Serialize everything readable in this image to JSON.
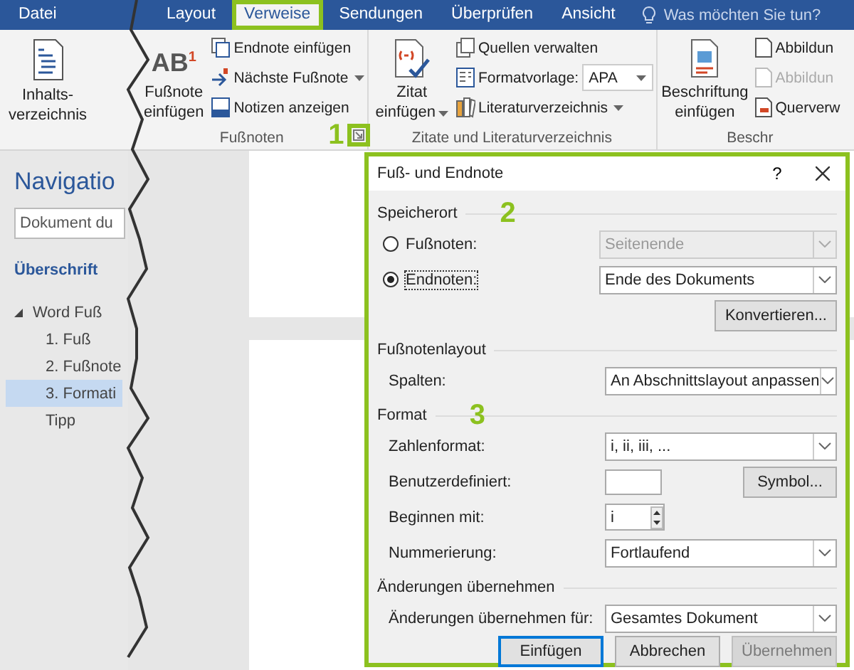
{
  "tabs": [
    {
      "label": "Datei",
      "selected": false
    },
    {
      "label": "Layout",
      "selected": false
    },
    {
      "label": "Verweise",
      "selected": true
    },
    {
      "label": "Sendungen",
      "selected": false
    },
    {
      "label": "Überprüfen",
      "selected": false
    },
    {
      "label": "Ansicht",
      "selected": false
    }
  ],
  "tell_me": "Was möchten Sie tun?",
  "ribbon": {
    "toc_button": [
      "Inhalts-",
      "verzeichnis"
    ],
    "footnotes": {
      "title": "Fußnoten",
      "callout": "1",
      "glyph": "AB$^{1}$",
      "insert_button": [
        "Fußnote",
        "einfügen"
      ],
      "commands": [
        "Endnote einfügen",
        "Nächste Fußnote",
        "Notizen anzeigen"
      ]
    },
    "citations": {
      "title": "Zitate und Literaturverzeichnis",
      "insert_button": [
        "Zitat",
        "einfügen"
      ],
      "manage_sources": "Quellen verwalten",
      "style_label": "Formatvorlage:",
      "style_value": "APA",
      "bibliography": "Literaturverzeichnis"
    },
    "captions": {
      "title": "Beschr",
      "insert_button": [
        "Beschriftung",
        "einfügen"
      ],
      "commands": [
        {
          "label": "Abbildun",
          "disabled": false
        },
        {
          "label": "Abbildun",
          "disabled": true
        },
        {
          "label": "Querverw",
          "disabled": false
        }
      ]
    }
  },
  "navigation": {
    "title": "Navigatio",
    "search": {
      "placeholder": "Dokument du"
    },
    "tab": "Überschrift",
    "tree": [
      {
        "label": "Word Fuß",
        "expanded": true,
        "selected": false,
        "children": [
          {
            "label": "1. Fuß",
            "selected": false
          },
          {
            "label": "2. Fußnote",
            "selected": false
          },
          {
            "label": "3. Formati",
            "selected": true
          },
          {
            "label": "Tipp",
            "selected": false
          }
        ]
      }
    ]
  },
  "dialog": {
    "title": "Fuß- und Endnote",
    "help": "?",
    "sections": [
      {
        "kind": "location",
        "title": "Speicherort",
        "callout": "2",
        "options": [
          {
            "label": "Fußnoten:",
            "selected": false,
            "value": "Seitenende",
            "disabled": true
          },
          {
            "label": "Endnoten:",
            "selected": true,
            "value": "Ende des Dokuments",
            "disabled": false
          }
        ],
        "button": "Konvertieren..."
      },
      {
        "kind": "rows",
        "title": "Fußnotenlayout",
        "rows": [
          {
            "kind": "dropdown",
            "label": "Spalten:",
            "value": "An Abschnittslayout anpassen"
          }
        ]
      },
      {
        "kind": "rows",
        "title": "Format",
        "callout": "3",
        "rows": [
          {
            "kind": "dropdown",
            "label": "Zahlenformat:",
            "value": "i, ii, iii, ..."
          },
          {
            "kind": "text",
            "label": "Benutzerdefiniert:",
            "button": "Symbol..."
          },
          {
            "kind": "spinner",
            "label": "Beginnen mit:",
            "value": "i"
          },
          {
            "kind": "dropdown",
            "label": "Nummerierung:",
            "value": "Fortlaufend"
          }
        ]
      },
      {
        "kind": "rows",
        "title": "Änderungen übernehmen",
        "rows": [
          {
            "kind": "dropdown",
            "label": "Änderungen übernehmen für:",
            "value": "Gesamtes Dokument"
          }
        ]
      }
    ],
    "buttons": [
      {
        "label": "Einfügen",
        "default": true,
        "disabled": false
      },
      {
        "label": "Abbrechen",
        "default": false,
        "disabled": false
      },
      {
        "label": "Übernehmen",
        "default": false,
        "disabled": true
      }
    ]
  }
}
